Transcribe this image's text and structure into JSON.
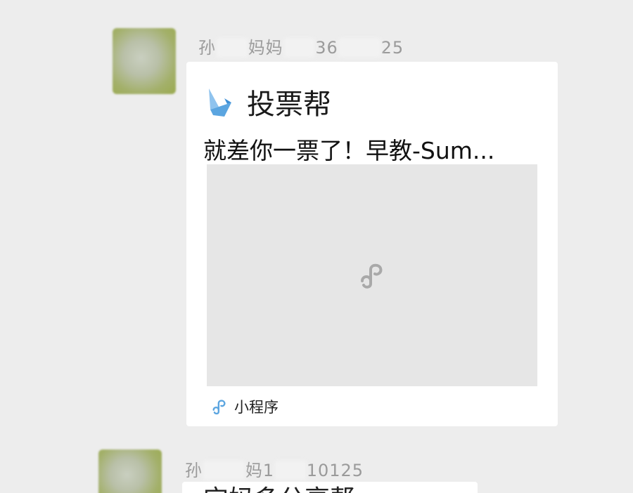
{
  "message1": {
    "sender_name_parts": [
      "孙",
      "妈妈",
      "36",
      "25"
    ],
    "card": {
      "app_name": "投票帮",
      "title": "就差你一票了！早教-Sum...",
      "footer_label": "小程序",
      "logo_icon": "bird-logo-icon",
      "preview_icon": "mini-program-icon"
    }
  },
  "message2": {
    "sender_name_parts": [
      "孙",
      "妈",
      "1",
      "10125"
    ],
    "text_partial": "宝妈多分享帮"
  },
  "colors": {
    "background": "#ededed",
    "card": "#ffffff",
    "preview_bg": "#e6e6e6",
    "logo_blue": "#5ba5e0"
  }
}
